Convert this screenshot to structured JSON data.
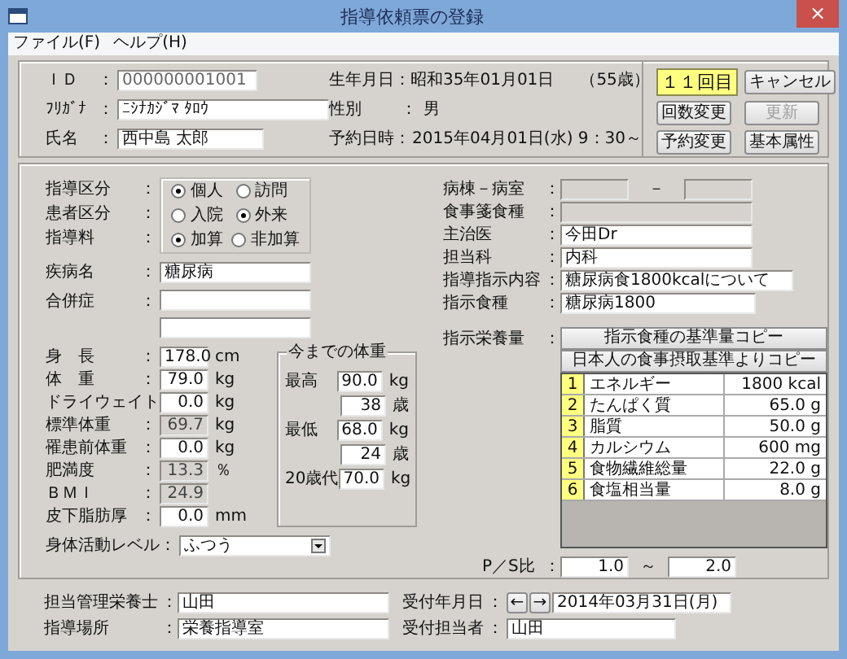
{
  "window": {
    "title": "指導依頼票の登録",
    "close": "×"
  },
  "menu": [
    "ファイル(F)",
    "ヘルプ(H)"
  ],
  "patient": [
    {
      "label": "ＩＤ",
      "sep": "：",
      "value": "000000001001",
      "readonly": true
    },
    {
      "label": "ﾌﾘｶﾞﾅ",
      "sep": "：",
      "value": "ﾆｼﾅｶｼﾞﾏ ﾀﾛｳ",
      "readonly": false
    },
    {
      "label": "氏名",
      "sep": "：",
      "value": "西中島 太郎",
      "readonly": false
    }
  ],
  "info": [
    {
      "label": "生年月日",
      "sep": "：",
      "value": "昭和35年01月01日",
      "extra": "（55歳）"
    },
    {
      "label": "性別",
      "sep": "：",
      "value": "男"
    },
    {
      "label": "予約日時",
      "sep": "：",
      "value": "2015年04月01日(水)  9：30～"
    }
  ],
  "visit_count": "１１回目",
  "buttons": [
    {
      "label": "キャンセル",
      "disabled": false
    },
    {
      "label": "回数変更",
      "disabled": false
    },
    {
      "label": "更新",
      "disabled": true
    },
    {
      "label": "予約変更",
      "disabled": false
    },
    {
      "label": "基本属性",
      "disabled": false
    }
  ],
  "radio_groups": [
    {
      "label": "指導区分",
      "sep": "：",
      "options": [
        {
          "label": "個人",
          "selected": true
        },
        {
          "label": "訪問",
          "selected": false
        }
      ]
    },
    {
      "label": "患者区分",
      "sep": "：",
      "options": [
        {
          "label": "入院",
          "selected": false
        },
        {
          "label": "外来",
          "selected": true
        }
      ]
    },
    {
      "label": "指導料",
      "sep": "：",
      "options": [
        {
          "label": "加算",
          "selected": true
        },
        {
          "label": "非加算",
          "selected": false
        }
      ]
    }
  ],
  "disease": {
    "label": "疾病名",
    "sep": "：",
    "value": "糖尿病"
  },
  "complication": {
    "label": "合併症",
    "sep": "："
  },
  "measurements": [
    {
      "label": "身　長",
      "sep": "：",
      "value": "178.0",
      "unit": "cm",
      "readonly": false
    },
    {
      "label": "体　重",
      "sep": "：",
      "value": "79.0",
      "unit": "kg",
      "readonly": false
    },
    {
      "label": "ドライウェイト",
      "value": "0.0",
      "unit": "kg",
      "readonly": false
    },
    {
      "label": "標準体重",
      "sep": "：",
      "value": "69.7",
      "unit": "kg",
      "readonly": true
    },
    {
      "label": "罹患前体重",
      "sep": "：",
      "value": "0.0",
      "unit": "kg",
      "readonly": false
    },
    {
      "label": "肥満度",
      "sep": "：",
      "value": "13.3",
      "unit": "％",
      "readonly": true
    },
    {
      "label": "ＢＭＩ",
      "sep": "：",
      "value": "24.9",
      "readonly": true
    },
    {
      "label": "皮下脂肪厚",
      "sep": "：",
      "value": "0.0",
      "unit": "mm",
      "readonly": false
    }
  ],
  "activity": {
    "label": "身体活動レベル",
    "sep": "：",
    "value": "ふつう"
  },
  "weight_history": {
    "title": "今までの体重",
    "rows": [
      {
        "label": "最高",
        "value": "90.0",
        "unit": "kg"
      },
      {
        "value": "38",
        "unit": "歳"
      },
      {
        "label": "最低",
        "value": "68.0",
        "unit": "kg"
      },
      {
        "value": "24",
        "unit": "歳"
      },
      {
        "label": "20歳代",
        "value": "70.0",
        "unit": "kg"
      }
    ]
  },
  "ward": {
    "label": "病棟－病室",
    "sep": "：",
    "dash": "－"
  },
  "meal_type": {
    "label": "食事箋食種",
    "sep": "："
  },
  "orders": [
    {
      "label": "主治医",
      "sep": "：",
      "value": "今田Dr"
    },
    {
      "label": "担当科",
      "sep": "：",
      "value": "内科"
    },
    {
      "label": "指導指示内容",
      "sep": "：",
      "value": "糖尿病食1800kcalについて"
    },
    {
      "label": "指示食種",
      "sep": "：",
      "value": "糖尿病1800"
    }
  ],
  "nutrition": {
    "label": "指示栄養量",
    "sep": "：",
    "copy_buttons": [
      "指示食種の基準量コピー",
      "日本人の食事摂取基準よりコピー"
    ],
    "rows": [
      {
        "no": "1",
        "name": "エネルギー",
        "value": "1800 kcal"
      },
      {
        "no": "2",
        "name": "たんぱく質",
        "value": "65.0 g"
      },
      {
        "no": "3",
        "name": "脂質",
        "value": "50.0 g"
      },
      {
        "no": "4",
        "name": "カルシウム",
        "value": "600 mg"
      },
      {
        "no": "5",
        "name": "食物繊維総量",
        "value": "22.0 g"
      },
      {
        "no": "6",
        "name": "食塩相当量",
        "value": "8.0 g"
      }
    ]
  },
  "ps_ratio": {
    "label": "P／S比",
    "sep": "：",
    "from": "1.0",
    "tilde": "～",
    "to": "2.0"
  },
  "staff": [
    {
      "label": "担当管理栄養士",
      "sep": "：",
      "value": "山田"
    },
    {
      "label": "指導場所",
      "sep": "：",
      "value": "栄養指導室"
    }
  ],
  "reception": {
    "date_label": "受付年月日",
    "date_sep": "：",
    "prev": "←",
    "next": "→",
    "date": "2014年03月31日(月)",
    "person_label": "受付担当者",
    "person_sep": "：",
    "person": "山田"
  }
}
